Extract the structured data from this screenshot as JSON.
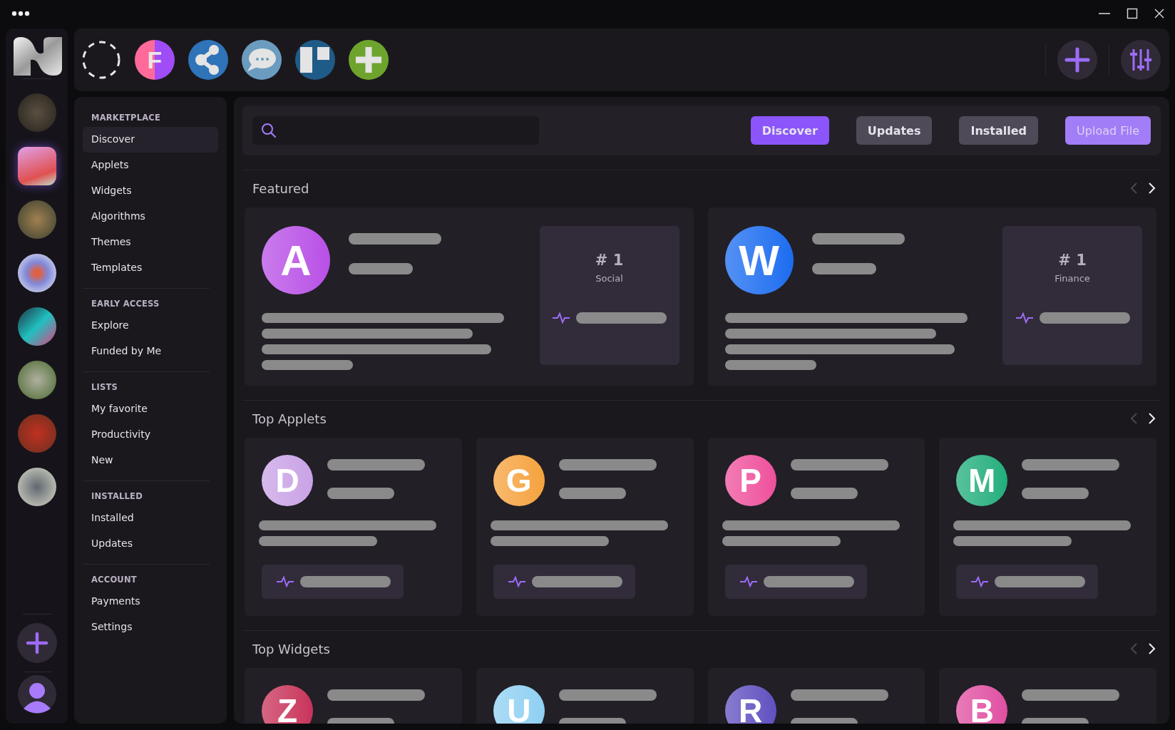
{
  "rail": {
    "apps": [
      {
        "selected": false
      },
      {
        "selected": true
      },
      {
        "selected": false
      },
      {
        "selected": false
      },
      {
        "selected": false
      },
      {
        "selected": false
      },
      {
        "selected": false
      },
      {
        "selected": false
      }
    ]
  },
  "top_apps": [
    {
      "kind": "empty"
    },
    {
      "kind": "letter",
      "letter": "F"
    },
    {
      "kind": "share"
    },
    {
      "kind": "chat"
    },
    {
      "kind": "board"
    },
    {
      "kind": "plus"
    }
  ],
  "nav": [
    {
      "heading": "MARKETPLACE",
      "items": [
        {
          "label": "Discover",
          "selected": true
        },
        {
          "label": "Applets",
          "selected": false
        },
        {
          "label": "Widgets",
          "selected": false
        },
        {
          "label": "Algorithms",
          "selected": false
        },
        {
          "label": "Themes",
          "selected": false
        },
        {
          "label": "Templates",
          "selected": false
        }
      ]
    },
    {
      "heading": "EARLY ACCESS",
      "items": [
        {
          "label": "Explore",
          "selected": false
        },
        {
          "label": "Funded by Me",
          "selected": false
        }
      ]
    },
    {
      "heading": "LISTS",
      "items": [
        {
          "label": "My favorite",
          "selected": false
        },
        {
          "label": "Productivity",
          "selected": false
        },
        {
          "label": "New",
          "selected": false
        }
      ]
    },
    {
      "heading": "INSTALLED",
      "items": [
        {
          "label": "Installed",
          "selected": false
        },
        {
          "label": "Updates",
          "selected": false
        }
      ]
    },
    {
      "heading": "ACCOUNT",
      "items": [
        {
          "label": "Payments",
          "selected": false
        },
        {
          "label": "Settings",
          "selected": false
        }
      ]
    }
  ],
  "tabs": [
    {
      "label": "Discover",
      "selected": true
    },
    {
      "label": "Updates",
      "selected": false
    },
    {
      "label": "Installed",
      "selected": false
    }
  ],
  "upload_button": "Upload File",
  "sections": [
    {
      "title": "Featured",
      "kind": "featured",
      "prev_disabled": true,
      "items": [
        {
          "letter": "A",
          "color": "#b84fe6",
          "rank": "# 1",
          "category": "Social"
        },
        {
          "letter": "W",
          "color": "#1a6cf0",
          "rank": "# 1",
          "category": "Finance"
        }
      ]
    },
    {
      "title": "Top Applets",
      "kind": "grid",
      "prev_disabled": true,
      "items": [
        {
          "letter": "D",
          "color": "#c9a2e6"
        },
        {
          "letter": "G",
          "color": "#f5a23c"
        },
        {
          "letter": "P",
          "color": "#ee4f9c"
        },
        {
          "letter": "M",
          "color": "#1fae7c"
        }
      ]
    },
    {
      "title": "Top Widgets",
      "kind": "grid",
      "prev_disabled": true,
      "items": [
        {
          "letter": "Z",
          "color": "#c8325a"
        },
        {
          "letter": "U",
          "color": "#8fd0f2"
        },
        {
          "letter": "R",
          "color": "#6050c0"
        },
        {
          "letter": "B",
          "color": "#e04fa2"
        }
      ]
    }
  ]
}
